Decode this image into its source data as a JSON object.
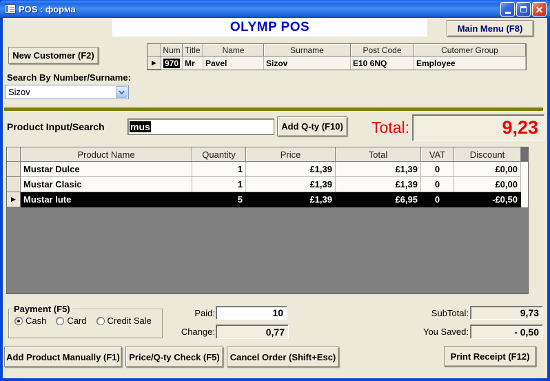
{
  "window": {
    "title": "POS : форма"
  },
  "header": {
    "app_title": "OLYMP POS",
    "main_menu_button": "Main Menu (F8)"
  },
  "customer_section": {
    "new_customer_button": "New Customer (F2)",
    "search_label": "Search By Number/Surname:",
    "search_value": "Sizov",
    "table": {
      "columns": [
        "Num",
        "Title",
        "Name",
        "Surname",
        "Post Code",
        "Cutomer Group"
      ],
      "rows": [
        {
          "num": "970",
          "title": "Mr",
          "name": "Pavel",
          "surname": "Sizov",
          "post_code": "E10 6NQ",
          "group": "Employee"
        }
      ]
    }
  },
  "product_section": {
    "input_label": "Product Input/Search",
    "input_value": "mus",
    "add_qty_button": "Add Q-ty (F10)",
    "total_label": "Total:",
    "total_value": "9,23",
    "table": {
      "columns": [
        "Product Name",
        "Quantity",
        "Price",
        "Total",
        "VAT",
        "Discount"
      ],
      "rows": [
        {
          "name": "Mustar Dulce",
          "qty": "1",
          "price": "£1,39",
          "total": "£1,39",
          "vat": "0",
          "discount": "£0,00",
          "selected": false
        },
        {
          "name": "Mustar Clasic",
          "qty": "1",
          "price": "£1,39",
          "total": "£1,39",
          "vat": "0",
          "discount": "£0,00",
          "selected": false
        },
        {
          "name": "Mustar lute",
          "qty": "5",
          "price": "£1,39",
          "total": "£6,95",
          "vat": "0",
          "discount": "-£0,50",
          "selected": true
        }
      ]
    }
  },
  "payment_section": {
    "group_label": "Payment (F5)",
    "options": [
      {
        "label": "Cash",
        "checked": true
      },
      {
        "label": "Card",
        "checked": false
      },
      {
        "label": "Credit Sale",
        "checked": false
      }
    ],
    "paid_label": "Paid:",
    "paid_value": "10",
    "change_label": "Change:",
    "change_value": "0,77",
    "subtotal_label": "SubTotal:",
    "subtotal_value": "9,73",
    "you_saved_label": "You Saved:",
    "you_saved_value": "- 0,50"
  },
  "footer_buttons": {
    "add_product": "Add Product Manually (F1)",
    "price_check": "Price/Q-ty Check (F5)",
    "cancel_order": "Cancel Order (Shift+Esc)",
    "print_receipt": "Print Receipt (F12)"
  },
  "colors": {
    "app_title_blue": "#0000D8",
    "total_red": "#EE0000",
    "divider_olive": "#808000",
    "selection_bg": "#000000",
    "selection_fg": "#FFFFFF"
  }
}
